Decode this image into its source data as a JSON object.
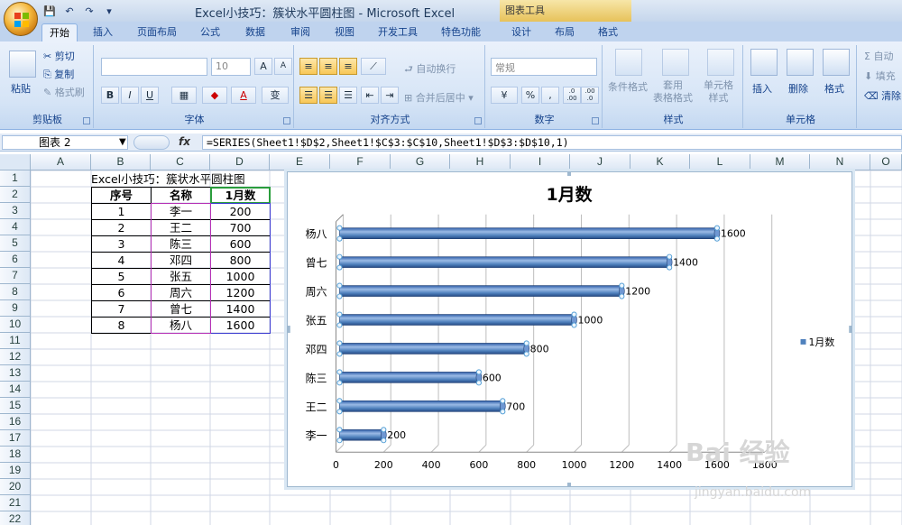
{
  "window": {
    "title": "Excel小技巧：簇状水平圆柱图 - Microsoft Excel",
    "contextual_tools": "图表工具"
  },
  "tabs": [
    {
      "label": "开始",
      "active": true
    },
    {
      "label": "插入"
    },
    {
      "label": "页面布局"
    },
    {
      "label": "公式"
    },
    {
      "label": "数据"
    },
    {
      "label": "审阅"
    },
    {
      "label": "视图"
    },
    {
      "label": "开发工具"
    },
    {
      "label": "特色功能"
    },
    {
      "label": "设计"
    },
    {
      "label": "布局"
    },
    {
      "label": "格式"
    }
  ],
  "ribbon": {
    "clipboard": {
      "label": "剪贴板",
      "paste": "粘贴",
      "cut": "剪切",
      "copy": "复制",
      "painter": "格式刷"
    },
    "font": {
      "label": "字体",
      "font_size": "10",
      "bold": "B",
      "italic": "I",
      "underline": "U",
      "grow": "A",
      "shrink": "A",
      "wen": "变"
    },
    "alignment": {
      "label": "对齐方式",
      "wrap": "自动换行",
      "merge": "合并后居中"
    },
    "number": {
      "label": "数字",
      "format": "常规",
      "percent": "%",
      "comma": ",",
      "inc": ".0 .00",
      "dec": ".00 .0"
    },
    "styles": {
      "label": "样式",
      "conditional": "条件格式",
      "table": "套用\n表格格式",
      "cell": "单元格\n样式"
    },
    "cells": {
      "label": "单元格",
      "insert": "插入",
      "delete": "删除",
      "format": "格式"
    },
    "editing": {
      "autosum": "自动",
      "fill": "填充",
      "clear": "清除"
    }
  },
  "formula_bar": {
    "name_box": "图表 2",
    "fx": "fx",
    "formula": "=SERIES(Sheet1!$D$2,Sheet1!$C$3:$C$10,Sheet1!$D$3:$D$10,1)"
  },
  "columns": [
    "A",
    "B",
    "C",
    "D",
    "E",
    "F",
    "G",
    "H",
    "I",
    "J",
    "K",
    "L",
    "M",
    "N",
    "O"
  ],
  "rows": [
    "1",
    "2",
    "3",
    "4",
    "5",
    "6",
    "7",
    "8",
    "9",
    "10",
    "11",
    "12",
    "13",
    "14",
    "15",
    "16",
    "17",
    "18",
    "19",
    "20",
    "21",
    "22"
  ],
  "sheet": {
    "title_cell": "Excel小技巧：簇状水平圆柱图",
    "headers": [
      "序号",
      "名称",
      "1月数"
    ],
    "table": [
      [
        "1",
        "李一",
        "200"
      ],
      [
        "2",
        "王二",
        "700"
      ],
      [
        "3",
        "陈三",
        "600"
      ],
      [
        "4",
        "邓四",
        "800"
      ],
      [
        "5",
        "张五",
        "1000"
      ],
      [
        "6",
        "周六",
        "1200"
      ],
      [
        "7",
        "曾七",
        "1400"
      ],
      [
        "8",
        "杨八",
        "1600"
      ]
    ]
  },
  "chart_data": {
    "type": "bar",
    "orientation": "horizontal",
    "title": "1月数",
    "categories": [
      "李一",
      "王二",
      "陈三",
      "邓四",
      "张五",
      "周六",
      "曾七",
      "杨八"
    ],
    "series": [
      {
        "name": "1月数",
        "values": [
          200,
          700,
          600,
          800,
          1000,
          1200,
          1400,
          1600
        ],
        "color": "#4f81bd"
      }
    ],
    "xlim": [
      0,
      1800
    ],
    "xticks": [
      0,
      200,
      400,
      600,
      800,
      1000,
      1200,
      1400,
      1600,
      1800
    ],
    "grid": true,
    "legend": "right",
    "data_labels": true
  },
  "watermark": {
    "main": "Bai 经验",
    "sub": "jingyan.baidu.com"
  }
}
